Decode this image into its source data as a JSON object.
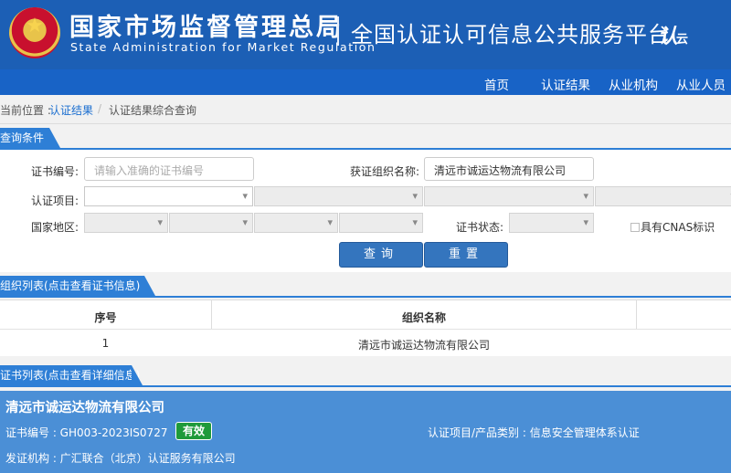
{
  "header": {
    "agency_cn": "国家市场监督管理总局",
    "agency_en": "State Administration for Market Regulation",
    "platform_title": "全国认证认可信息公共服务平台",
    "logo_text": "认",
    "logo_sub": "云"
  },
  "nav": {
    "items": [
      "首页",
      "认证结果",
      "从业机构",
      "从业人员"
    ]
  },
  "breadcrumb": {
    "prefix": "当前位置 :",
    "link": "认证结果",
    "separator": "/",
    "current": "认证结果综合查询"
  },
  "query": {
    "section_title": "查询条件",
    "cert_no_label": "证书编号:",
    "cert_no_placeholder": "请输入准确的证书编号",
    "org_name_label": "获证组织名称:",
    "org_name_value": "清远市诚运达物流有限公司",
    "project_label": "认证项目:",
    "region_label": "国家地区:",
    "status_label": "证书状态:",
    "cnas_label": "具有CNAS标识",
    "search_button": "查询",
    "reset_button": "重置"
  },
  "org_list": {
    "section_title": "组织列表(点击查看证书信息)",
    "columns": [
      "序号",
      "组织名称"
    ],
    "rows": [
      {
        "index": "1",
        "name": "清远市诚运达物流有限公司"
      }
    ]
  },
  "cert_list": {
    "section_title": "证书列表(点击查看详细信息)",
    "cert": {
      "org_name": "清远市诚运达物流有限公司",
      "cert_no_text": "证书编号 : GH003-2023IS0727",
      "status": "有效",
      "project_text": "认证项目/产品类别 : 信息安全管理体系认证",
      "issuer_text": "发证机构 : 广汇联合（北京）认证服务有限公司"
    }
  },
  "colors": {
    "header_bg": "#1c5fb5",
    "nav_bg": "#1863c6",
    "accent": "#2e7fd6",
    "card_bg": "#4b8fd6",
    "status_green": "#1f9a3a"
  }
}
